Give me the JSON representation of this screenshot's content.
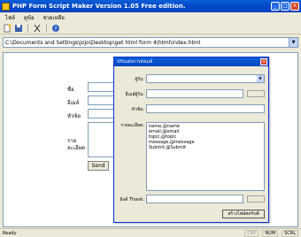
{
  "window": {
    "title": "PHP Form Script Maker Version 1.05 Free edition."
  },
  "menu": [
    "ไฟล์",
    "ดูข้อ",
    "ช่วยเหลือ"
  ],
  "toolbar": {
    "icons": [
      "new-file-icon",
      "save-icon",
      "cut-icon",
      "help-icon"
    ]
  },
  "path": {
    "value": "C:\\Documents and Settings\\jojo\\Desktop\\get html form 4\\html\\index.html"
  },
  "form": {
    "labels": [
      "ชื่อ",
      "อีเมล์",
      "หัวข้อ",
      "ราย",
      "ละเอียด"
    ],
    "send_label": "Send"
  },
  "dialog": {
    "title": "ปรับแต่งการส่งเมล์",
    "labels": {
      "to": "ผู้รับ:",
      "from": "อีเมล์ผู้รับ:",
      "subject": "หัวข้อ:",
      "fields": "รายละเอียด:",
      "thanks": "ลิงค์ Thank:"
    },
    "fields": [
      "name,@name",
      "email,@email",
      "topic,@topic",
      "message,@message",
      "Submit,@Submit"
    ],
    "action_label": "สร้างไฟล์สคริปต์"
  },
  "status": {
    "text": "Ready",
    "indicators": [
      "CAP",
      "NUM",
      "SCRL"
    ]
  }
}
